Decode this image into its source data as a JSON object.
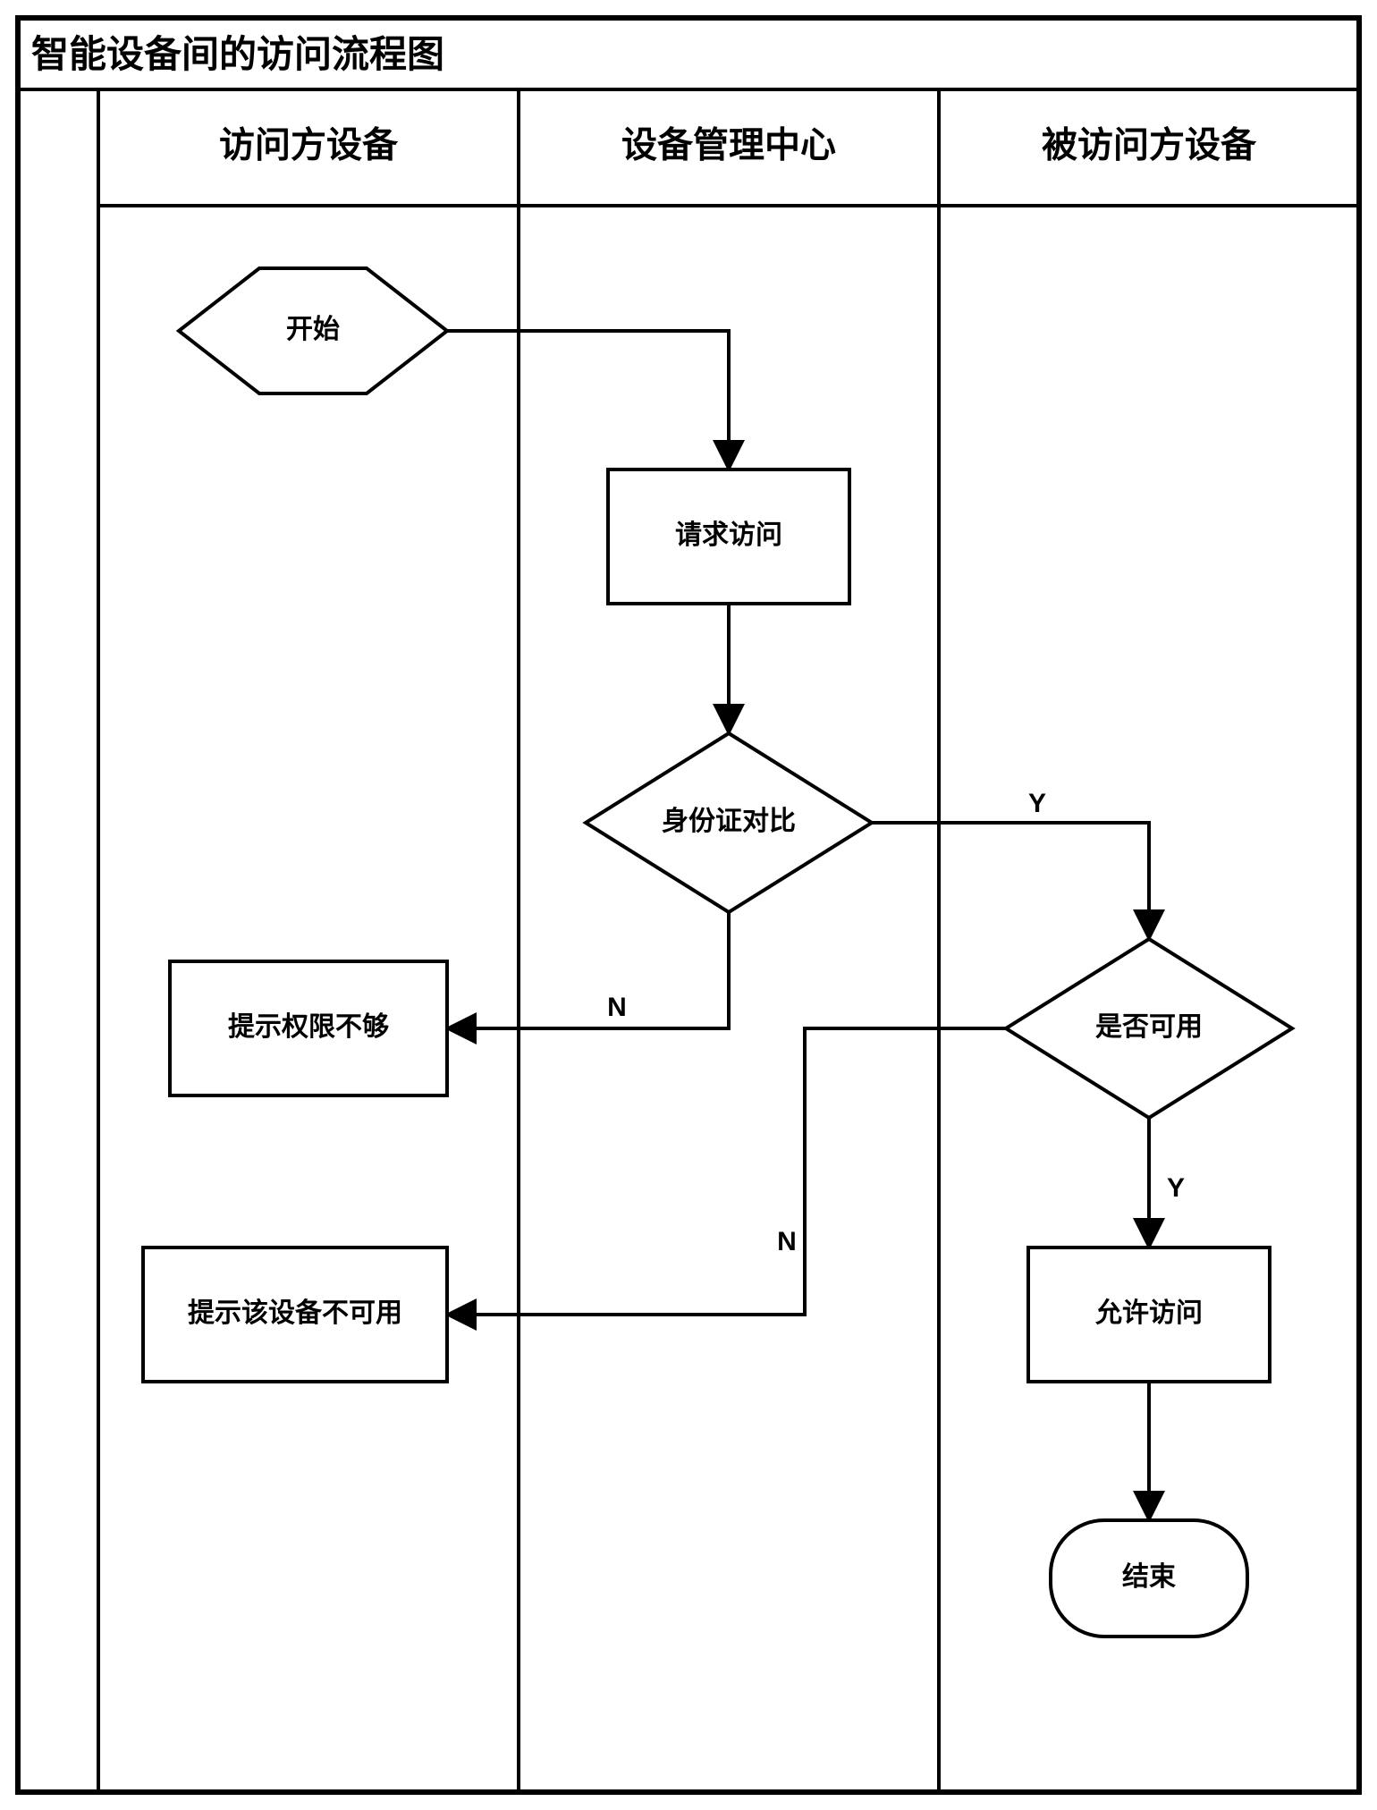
{
  "title": "智能设备间的访问流程图",
  "lanes": {
    "visitor": "访问方设备",
    "center": "设备管理中心",
    "target": "被访问方设备"
  },
  "nodes": {
    "start": "开始",
    "request": "请求访问",
    "identity": "身份证对比",
    "noAuth": "提示权限不够",
    "available": "是否可用",
    "notAvail": "提示该设备不可用",
    "allow": "允许访问",
    "end": "结束"
  },
  "labels": {
    "yes": "Y",
    "no": "N"
  },
  "diagram": {
    "type": "swimlane-flowchart",
    "lanes": [
      "访问方设备",
      "设备管理中心",
      "被访问方设备"
    ],
    "flow": [
      {
        "id": "start",
        "lane": 0,
        "type": "terminator",
        "text": "开始"
      },
      {
        "id": "request",
        "lane": 1,
        "type": "process",
        "text": "请求访问"
      },
      {
        "id": "identity",
        "lane": 1,
        "type": "decision",
        "text": "身份证对比"
      },
      {
        "id": "noAuth",
        "lane": 0,
        "type": "process",
        "text": "提示权限不够"
      },
      {
        "id": "available",
        "lane": 2,
        "type": "decision",
        "text": "是否可用"
      },
      {
        "id": "notAvail",
        "lane": 0,
        "type": "process",
        "text": "提示该设备不可用"
      },
      {
        "id": "allow",
        "lane": 2,
        "type": "process",
        "text": "允许访问"
      },
      {
        "id": "end",
        "lane": 2,
        "type": "terminator",
        "text": "结束"
      }
    ],
    "edges": [
      {
        "from": "start",
        "to": "request"
      },
      {
        "from": "request",
        "to": "identity"
      },
      {
        "from": "identity",
        "to": "noAuth",
        "label": "N"
      },
      {
        "from": "identity",
        "to": "available",
        "label": "Y"
      },
      {
        "from": "available",
        "to": "notAvail",
        "label": "N"
      },
      {
        "from": "available",
        "to": "allow",
        "label": "Y"
      },
      {
        "from": "allow",
        "to": "end"
      }
    ]
  }
}
